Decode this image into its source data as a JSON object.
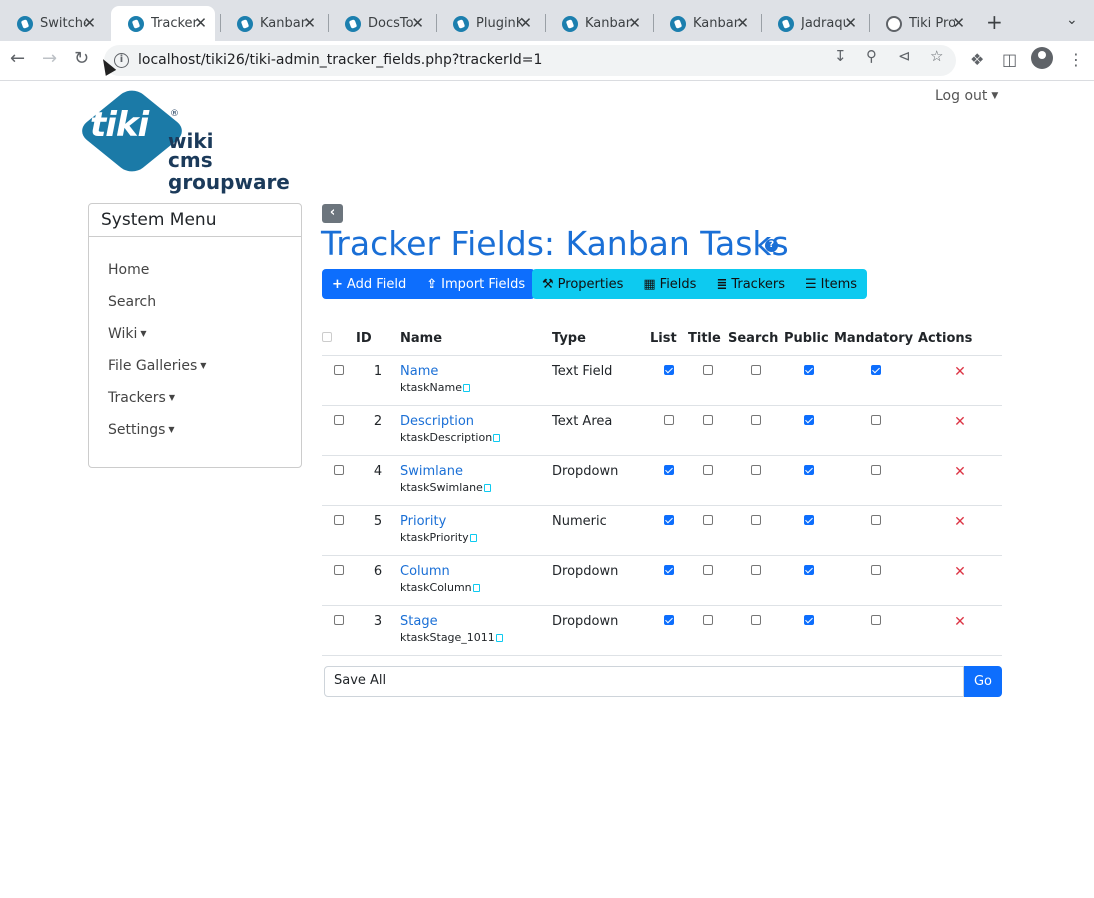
{
  "browser": {
    "tabs": [
      {
        "label": "Switche",
        "active": false,
        "favicon": "tiki-icon"
      },
      {
        "label": "Tracker",
        "active": true,
        "favicon": "tiki-icon"
      },
      {
        "label": "Kanban",
        "active": false,
        "favicon": "tiki-icon"
      },
      {
        "label": "DocsTo",
        "active": false,
        "favicon": "tiki-icon"
      },
      {
        "label": "PluginK",
        "active": false,
        "favicon": "tiki-icon"
      },
      {
        "label": "Kanban",
        "active": false,
        "favicon": "tiki-icon"
      },
      {
        "label": "Kanban",
        "active": false,
        "favicon": "tiki-icon"
      },
      {
        "label": "Jadraqu",
        "active": false,
        "favicon": "tiki-icon"
      },
      {
        "label": "Tiki Pro",
        "active": false,
        "favicon": "globe-icon"
      }
    ],
    "url": "localhost/tiki26/tiki-admin_tracker_fields.php?trackerId=1"
  },
  "header": {
    "logo_word": "tiki",
    "logo_lines": [
      "wiki",
      "cms",
      "groupware"
    ],
    "logout_label": "Log out"
  },
  "sidebar": {
    "title": "System Menu",
    "items": [
      {
        "label": "Home",
        "has_caret": false
      },
      {
        "label": "Search",
        "has_caret": false
      },
      {
        "label": "Wiki",
        "has_caret": true
      },
      {
        "label": "File Galleries",
        "has_caret": true
      },
      {
        "label": "Trackers",
        "has_caret": true
      },
      {
        "label": "Settings",
        "has_caret": true
      }
    ]
  },
  "main": {
    "title": "Tracker Fields: Kanban Tasks",
    "buttons_primary": [
      {
        "label": "Add Field",
        "icon": "plus-icon"
      },
      {
        "label": "Import Fields",
        "icon": "upload-icon"
      }
    ],
    "buttons_info": [
      {
        "label": "Properties",
        "icon": "wrench-icon"
      },
      {
        "label": "Fields",
        "icon": "table-icon"
      },
      {
        "label": "Trackers",
        "icon": "database-icon"
      },
      {
        "label": "Items",
        "icon": "list-icon"
      }
    ],
    "table": {
      "headers": [
        "ID",
        "Name",
        "Type",
        "List",
        "Title",
        "Search",
        "Public",
        "Mandatory",
        "Actions"
      ],
      "rows": [
        {
          "id": "1",
          "name": "Name",
          "perm": "ktaskName",
          "type": "Text Field",
          "list": true,
          "title": false,
          "search": false,
          "public": true,
          "mandatory": true
        },
        {
          "id": "2",
          "name": "Description",
          "perm": "ktaskDescription",
          "type": "Text Area",
          "list": false,
          "title": false,
          "search": false,
          "public": true,
          "mandatory": false
        },
        {
          "id": "4",
          "name": "Swimlane",
          "perm": "ktaskSwimlane",
          "type": "Dropdown",
          "list": true,
          "title": false,
          "search": false,
          "public": true,
          "mandatory": false
        },
        {
          "id": "5",
          "name": "Priority",
          "perm": "ktaskPriority",
          "type": "Numeric",
          "list": true,
          "title": false,
          "search": false,
          "public": true,
          "mandatory": false
        },
        {
          "id": "6",
          "name": "Column",
          "perm": "ktaskColumn",
          "type": "Dropdown",
          "list": true,
          "title": false,
          "search": false,
          "public": true,
          "mandatory": false
        },
        {
          "id": "3",
          "name": "Stage",
          "perm": "ktaskStage_1011",
          "type": "Dropdown",
          "list": true,
          "title": false,
          "search": false,
          "public": true,
          "mandatory": false
        }
      ]
    },
    "bulk_action": {
      "selected": "Save All",
      "go_label": "Go"
    }
  },
  "colors": {
    "primary": "#0d6efd",
    "info": "#0dcaf0",
    "title": "#1a6fd6",
    "danger": "#dc3545"
  }
}
